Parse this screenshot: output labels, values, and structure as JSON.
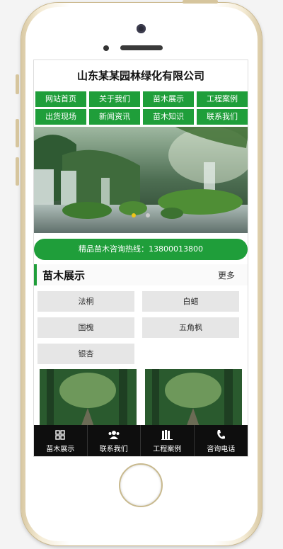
{
  "site": {
    "title": "山东某某园林绿化有限公司"
  },
  "nav": {
    "items": [
      {
        "label": "网站首页"
      },
      {
        "label": "关于我们"
      },
      {
        "label": "苗木展示"
      },
      {
        "label": "工程案例"
      },
      {
        "label": "出货现场"
      },
      {
        "label": "新闻资讯"
      },
      {
        "label": "苗木知识"
      },
      {
        "label": "联系我们"
      }
    ]
  },
  "banner": {
    "slides": 2,
    "active_slide": 1
  },
  "hotline": {
    "text": "精品苗木咨询热线：13800013800"
  },
  "section": {
    "title": "苗木展示",
    "more": "更多"
  },
  "tags": [
    {
      "label": "法桐"
    },
    {
      "label": "白蜡"
    },
    {
      "label": "国槐"
    },
    {
      "label": "五角枫"
    },
    {
      "label": "银杏"
    }
  ],
  "bottom_bar": {
    "items": [
      {
        "label": "苗木展示",
        "icon": "grid-icon"
      },
      {
        "label": "联系我们",
        "icon": "users-icon"
      },
      {
        "label": "工程案例",
        "icon": "books-icon"
      },
      {
        "label": "咨询电话",
        "icon": "phone-icon"
      }
    ]
  },
  "colors": {
    "accent": "#1f9e3a",
    "bottom_bar": "#0e0e0e",
    "tag_bg": "#e6e6e6"
  }
}
